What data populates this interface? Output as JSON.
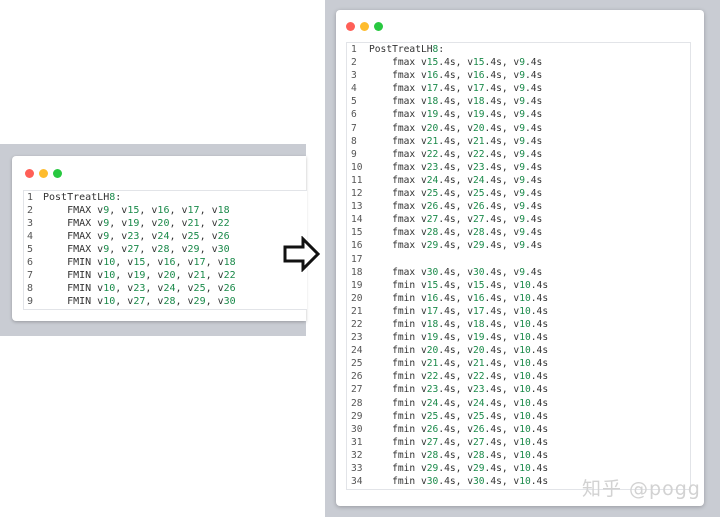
{
  "colors": {
    "dot_close": "#ff5f57",
    "dot_minimize": "#febc2e",
    "dot_zoom": "#28c840",
    "number_accent": "#1a8a4a"
  },
  "watermark": "知乎 @pogg",
  "arrow_icon": "right-arrow-outline-icon",
  "left_code": [
    {
      "n": "1",
      "parts": [
        [
          "t",
          "PostTreatLH"
        ],
        [
          "n",
          "8"
        ],
        [
          "t",
          ":"
        ]
      ]
    },
    {
      "n": "2",
      "parts": [
        [
          "t",
          "    FMAX v"
        ],
        [
          "n",
          "9"
        ],
        [
          "t",
          ", v"
        ],
        [
          "n",
          "15"
        ],
        [
          "t",
          ", v"
        ],
        [
          "n",
          "16"
        ],
        [
          "t",
          ", v"
        ],
        [
          "n",
          "17"
        ],
        [
          "t",
          ", v"
        ],
        [
          "n",
          "18"
        ]
      ]
    },
    {
      "n": "3",
      "parts": [
        [
          "t",
          "    FMAX v"
        ],
        [
          "n",
          "9"
        ],
        [
          "t",
          ", v"
        ],
        [
          "n",
          "19"
        ],
        [
          "t",
          ", v"
        ],
        [
          "n",
          "20"
        ],
        [
          "t",
          ", v"
        ],
        [
          "n",
          "21"
        ],
        [
          "t",
          ", v"
        ],
        [
          "n",
          "22"
        ]
      ]
    },
    {
      "n": "4",
      "parts": [
        [
          "t",
          "    FMAX v"
        ],
        [
          "n",
          "9"
        ],
        [
          "t",
          ", v"
        ],
        [
          "n",
          "23"
        ],
        [
          "t",
          ", v"
        ],
        [
          "n",
          "24"
        ],
        [
          "t",
          ", v"
        ],
        [
          "n",
          "25"
        ],
        [
          "t",
          ", v"
        ],
        [
          "n",
          "26"
        ]
      ]
    },
    {
      "n": "5",
      "parts": [
        [
          "t",
          "    FMAX v"
        ],
        [
          "n",
          "9"
        ],
        [
          "t",
          ", v"
        ],
        [
          "n",
          "27"
        ],
        [
          "t",
          ", v"
        ],
        [
          "n",
          "28"
        ],
        [
          "t",
          ", v"
        ],
        [
          "n",
          "29"
        ],
        [
          "t",
          ", v"
        ],
        [
          "n",
          "30"
        ]
      ]
    },
    {
      "n": "6",
      "parts": [
        [
          "t",
          "    FMIN v"
        ],
        [
          "n",
          "10"
        ],
        [
          "t",
          ", v"
        ],
        [
          "n",
          "15"
        ],
        [
          "t",
          ", v"
        ],
        [
          "n",
          "16"
        ],
        [
          "t",
          ", v"
        ],
        [
          "n",
          "17"
        ],
        [
          "t",
          ", v"
        ],
        [
          "n",
          "18"
        ]
      ]
    },
    {
      "n": "7",
      "parts": [
        [
          "t",
          "    FMIN v"
        ],
        [
          "n",
          "10"
        ],
        [
          "t",
          ", v"
        ],
        [
          "n",
          "19"
        ],
        [
          "t",
          ", v"
        ],
        [
          "n",
          "20"
        ],
        [
          "t",
          ", v"
        ],
        [
          "n",
          "21"
        ],
        [
          "t",
          ", v"
        ],
        [
          "n",
          "22"
        ]
      ]
    },
    {
      "n": "8",
      "parts": [
        [
          "t",
          "    FMIN v"
        ],
        [
          "n",
          "10"
        ],
        [
          "t",
          ", v"
        ],
        [
          "n",
          "23"
        ],
        [
          "t",
          ", v"
        ],
        [
          "n",
          "24"
        ],
        [
          "t",
          ", v"
        ],
        [
          "n",
          "25"
        ],
        [
          "t",
          ", v"
        ],
        [
          "n",
          "26"
        ]
      ]
    },
    {
      "n": "9",
      "parts": [
        [
          "t",
          "    FMIN v"
        ],
        [
          "n",
          "10"
        ],
        [
          "t",
          ", v"
        ],
        [
          "n",
          "27"
        ],
        [
          "t",
          ", v"
        ],
        [
          "n",
          "28"
        ],
        [
          "t",
          ", v"
        ],
        [
          "n",
          "29"
        ],
        [
          "t",
          ", v"
        ],
        [
          "n",
          "30"
        ]
      ]
    }
  ],
  "right_code": [
    {
      "n": "1",
      "parts": [
        [
          "t",
          "PostTreatLH"
        ],
        [
          "n",
          "8"
        ],
        [
          "t",
          ":"
        ]
      ]
    },
    {
      "n": "2",
      "parts": [
        [
          "t",
          "    fmax v"
        ],
        [
          "n",
          "15"
        ],
        [
          "t",
          ".4s, v"
        ],
        [
          "n",
          "15"
        ],
        [
          "t",
          ".4s, v"
        ],
        [
          "n",
          "9"
        ],
        [
          "t",
          ".4s"
        ]
      ]
    },
    {
      "n": "3",
      "parts": [
        [
          "t",
          "    fmax v"
        ],
        [
          "n",
          "16"
        ],
        [
          "t",
          ".4s, v"
        ],
        [
          "n",
          "16"
        ],
        [
          "t",
          ".4s, v"
        ],
        [
          "n",
          "9"
        ],
        [
          "t",
          ".4s"
        ]
      ]
    },
    {
      "n": "4",
      "parts": [
        [
          "t",
          "    fmax v"
        ],
        [
          "n",
          "17"
        ],
        [
          "t",
          ".4s, v"
        ],
        [
          "n",
          "17"
        ],
        [
          "t",
          ".4s, v"
        ],
        [
          "n",
          "9"
        ],
        [
          "t",
          ".4s"
        ]
      ]
    },
    {
      "n": "5",
      "parts": [
        [
          "t",
          "    fmax v"
        ],
        [
          "n",
          "18"
        ],
        [
          "t",
          ".4s, v"
        ],
        [
          "n",
          "18"
        ],
        [
          "t",
          ".4s, v"
        ],
        [
          "n",
          "9"
        ],
        [
          "t",
          ".4s"
        ]
      ]
    },
    {
      "n": "6",
      "parts": [
        [
          "t",
          "    fmax v"
        ],
        [
          "n",
          "19"
        ],
        [
          "t",
          ".4s, v"
        ],
        [
          "n",
          "19"
        ],
        [
          "t",
          ".4s, v"
        ],
        [
          "n",
          "9"
        ],
        [
          "t",
          ".4s"
        ]
      ]
    },
    {
      "n": "7",
      "parts": [
        [
          "t",
          "    fmax v"
        ],
        [
          "n",
          "20"
        ],
        [
          "t",
          ".4s, v"
        ],
        [
          "n",
          "20"
        ],
        [
          "t",
          ".4s, v"
        ],
        [
          "n",
          "9"
        ],
        [
          "t",
          ".4s"
        ]
      ]
    },
    {
      "n": "8",
      "parts": [
        [
          "t",
          "    fmax v"
        ],
        [
          "n",
          "21"
        ],
        [
          "t",
          ".4s, v"
        ],
        [
          "n",
          "21"
        ],
        [
          "t",
          ".4s, v"
        ],
        [
          "n",
          "9"
        ],
        [
          "t",
          ".4s"
        ]
      ]
    },
    {
      "n": "9",
      "parts": [
        [
          "t",
          "    fmax v"
        ],
        [
          "n",
          "22"
        ],
        [
          "t",
          ".4s, v"
        ],
        [
          "n",
          "22"
        ],
        [
          "t",
          ".4s, v"
        ],
        [
          "n",
          "9"
        ],
        [
          "t",
          ".4s"
        ]
      ]
    },
    {
      "n": "10",
      "parts": [
        [
          "t",
          "    fmax v"
        ],
        [
          "n",
          "23"
        ],
        [
          "t",
          ".4s, v"
        ],
        [
          "n",
          "23"
        ],
        [
          "t",
          ".4s, v"
        ],
        [
          "n",
          "9"
        ],
        [
          "t",
          ".4s"
        ]
      ]
    },
    {
      "n": "11",
      "parts": [
        [
          "t",
          "    fmax v"
        ],
        [
          "n",
          "24"
        ],
        [
          "t",
          ".4s, v"
        ],
        [
          "n",
          "24"
        ],
        [
          "t",
          ".4s, v"
        ],
        [
          "n",
          "9"
        ],
        [
          "t",
          ".4s"
        ]
      ]
    },
    {
      "n": "12",
      "parts": [
        [
          "t",
          "    fmax v"
        ],
        [
          "n",
          "25"
        ],
        [
          "t",
          ".4s, v"
        ],
        [
          "n",
          "25"
        ],
        [
          "t",
          ".4s, v"
        ],
        [
          "n",
          "9"
        ],
        [
          "t",
          ".4s"
        ]
      ]
    },
    {
      "n": "13",
      "parts": [
        [
          "t",
          "    fmax v"
        ],
        [
          "n",
          "26"
        ],
        [
          "t",
          ".4s, v"
        ],
        [
          "n",
          "26"
        ],
        [
          "t",
          ".4s, v"
        ],
        [
          "n",
          "9"
        ],
        [
          "t",
          ".4s"
        ]
      ]
    },
    {
      "n": "14",
      "parts": [
        [
          "t",
          "    fmax v"
        ],
        [
          "n",
          "27"
        ],
        [
          "t",
          ".4s, v"
        ],
        [
          "n",
          "27"
        ],
        [
          "t",
          ".4s, v"
        ],
        [
          "n",
          "9"
        ],
        [
          "t",
          ".4s"
        ]
      ]
    },
    {
      "n": "15",
      "parts": [
        [
          "t",
          "    fmax v"
        ],
        [
          "n",
          "28"
        ],
        [
          "t",
          ".4s, v"
        ],
        [
          "n",
          "28"
        ],
        [
          "t",
          ".4s, v"
        ],
        [
          "n",
          "9"
        ],
        [
          "t",
          ".4s"
        ]
      ]
    },
    {
      "n": "16",
      "parts": [
        [
          "t",
          "    fmax v"
        ],
        [
          "n",
          "29"
        ],
        [
          "t",
          ".4s, v"
        ],
        [
          "n",
          "29"
        ],
        [
          "t",
          ".4s, v"
        ],
        [
          "n",
          "9"
        ],
        [
          "t",
          ".4s"
        ]
      ]
    },
    {
      "n": "17",
      "parts": []
    },
    {
      "n": "18",
      "parts": [
        [
          "t",
          "    fmax v"
        ],
        [
          "n",
          "30"
        ],
        [
          "t",
          ".4s, v"
        ],
        [
          "n",
          "30"
        ],
        [
          "t",
          ".4s, v"
        ],
        [
          "n",
          "9"
        ],
        [
          "t",
          ".4s"
        ]
      ]
    },
    {
      "n": "19",
      "parts": [
        [
          "t",
          "    fmin v"
        ],
        [
          "n",
          "15"
        ],
        [
          "t",
          ".4s, v"
        ],
        [
          "n",
          "15"
        ],
        [
          "t",
          ".4s, v"
        ],
        [
          "n",
          "10"
        ],
        [
          "t",
          ".4s"
        ]
      ]
    },
    {
      "n": "20",
      "parts": [
        [
          "t",
          "    fmin v"
        ],
        [
          "n",
          "16"
        ],
        [
          "t",
          ".4s, v"
        ],
        [
          "n",
          "16"
        ],
        [
          "t",
          ".4s, v"
        ],
        [
          "n",
          "10"
        ],
        [
          "t",
          ".4s"
        ]
      ]
    },
    {
      "n": "21",
      "parts": [
        [
          "t",
          "    fmin v"
        ],
        [
          "n",
          "17"
        ],
        [
          "t",
          ".4s, v"
        ],
        [
          "n",
          "17"
        ],
        [
          "t",
          ".4s, v"
        ],
        [
          "n",
          "10"
        ],
        [
          "t",
          ".4s"
        ]
      ]
    },
    {
      "n": "22",
      "parts": [
        [
          "t",
          "    fmin v"
        ],
        [
          "n",
          "18"
        ],
        [
          "t",
          ".4s, v"
        ],
        [
          "n",
          "18"
        ],
        [
          "t",
          ".4s, v"
        ],
        [
          "n",
          "10"
        ],
        [
          "t",
          ".4s"
        ]
      ]
    },
    {
      "n": "23",
      "parts": [
        [
          "t",
          "    fmin v"
        ],
        [
          "n",
          "19"
        ],
        [
          "t",
          ".4s, v"
        ],
        [
          "n",
          "19"
        ],
        [
          "t",
          ".4s, v"
        ],
        [
          "n",
          "10"
        ],
        [
          "t",
          ".4s"
        ]
      ]
    },
    {
      "n": "24",
      "parts": [
        [
          "t",
          "    fmin v"
        ],
        [
          "n",
          "20"
        ],
        [
          "t",
          ".4s, v"
        ],
        [
          "n",
          "20"
        ],
        [
          "t",
          ".4s, v"
        ],
        [
          "n",
          "10"
        ],
        [
          "t",
          ".4s"
        ]
      ]
    },
    {
      "n": "25",
      "parts": [
        [
          "t",
          "    fmin v"
        ],
        [
          "n",
          "21"
        ],
        [
          "t",
          ".4s, v"
        ],
        [
          "n",
          "21"
        ],
        [
          "t",
          ".4s, v"
        ],
        [
          "n",
          "10"
        ],
        [
          "t",
          ".4s"
        ]
      ]
    },
    {
      "n": "26",
      "parts": [
        [
          "t",
          "    fmin v"
        ],
        [
          "n",
          "22"
        ],
        [
          "t",
          ".4s, v"
        ],
        [
          "n",
          "22"
        ],
        [
          "t",
          ".4s, v"
        ],
        [
          "n",
          "10"
        ],
        [
          "t",
          ".4s"
        ]
      ]
    },
    {
      "n": "27",
      "parts": [
        [
          "t",
          "    fmin v"
        ],
        [
          "n",
          "23"
        ],
        [
          "t",
          ".4s, v"
        ],
        [
          "n",
          "23"
        ],
        [
          "t",
          ".4s, v"
        ],
        [
          "n",
          "10"
        ],
        [
          "t",
          ".4s"
        ]
      ]
    },
    {
      "n": "28",
      "parts": [
        [
          "t",
          "    fmin v"
        ],
        [
          "n",
          "24"
        ],
        [
          "t",
          ".4s, v"
        ],
        [
          "n",
          "24"
        ],
        [
          "t",
          ".4s, v"
        ],
        [
          "n",
          "10"
        ],
        [
          "t",
          ".4s"
        ]
      ]
    },
    {
      "n": "29",
      "parts": [
        [
          "t",
          "    fmin v"
        ],
        [
          "n",
          "25"
        ],
        [
          "t",
          ".4s, v"
        ],
        [
          "n",
          "25"
        ],
        [
          "t",
          ".4s, v"
        ],
        [
          "n",
          "10"
        ],
        [
          "t",
          ".4s"
        ]
      ]
    },
    {
      "n": "30",
      "parts": [
        [
          "t",
          "    fmin v"
        ],
        [
          "n",
          "26"
        ],
        [
          "t",
          ".4s, v"
        ],
        [
          "n",
          "26"
        ],
        [
          "t",
          ".4s, v"
        ],
        [
          "n",
          "10"
        ],
        [
          "t",
          ".4s"
        ]
      ]
    },
    {
      "n": "31",
      "parts": [
        [
          "t",
          "    fmin v"
        ],
        [
          "n",
          "27"
        ],
        [
          "t",
          ".4s, v"
        ],
        [
          "n",
          "27"
        ],
        [
          "t",
          ".4s, v"
        ],
        [
          "n",
          "10"
        ],
        [
          "t",
          ".4s"
        ]
      ]
    },
    {
      "n": "32",
      "parts": [
        [
          "t",
          "    fmin v"
        ],
        [
          "n",
          "28"
        ],
        [
          "t",
          ".4s, v"
        ],
        [
          "n",
          "28"
        ],
        [
          "t",
          ".4s, v"
        ],
        [
          "n",
          "10"
        ],
        [
          "t",
          ".4s"
        ]
      ]
    },
    {
      "n": "33",
      "parts": [
        [
          "t",
          "    fmin v"
        ],
        [
          "n",
          "29"
        ],
        [
          "t",
          ".4s, v"
        ],
        [
          "n",
          "29"
        ],
        [
          "t",
          ".4s, v"
        ],
        [
          "n",
          "10"
        ],
        [
          "t",
          ".4s"
        ]
      ]
    },
    {
      "n": "34",
      "parts": [
        [
          "t",
          "    fmin v"
        ],
        [
          "n",
          "30"
        ],
        [
          "t",
          ".4s, v"
        ],
        [
          "n",
          "30"
        ],
        [
          "t",
          ".4s, v"
        ],
        [
          "n",
          "10"
        ],
        [
          "t",
          ".4s"
        ]
      ]
    }
  ]
}
